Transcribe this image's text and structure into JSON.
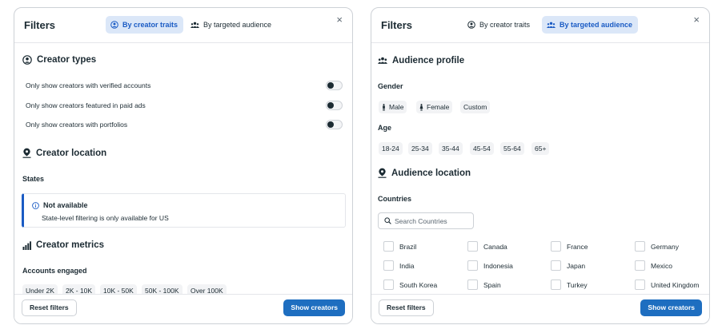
{
  "left_panel": {
    "title": "Filters",
    "tabs": [
      {
        "label": "By creator traits",
        "active": true
      },
      {
        "label": "By targeted audience",
        "active": false
      }
    ],
    "close_label": "×",
    "creator_types": {
      "title": "Creator types",
      "options": [
        {
          "label": "Only show creators with verified accounts",
          "on": true
        },
        {
          "label": "Only show creators featured in paid ads",
          "on": true
        },
        {
          "label": "Only show creators with portfolios",
          "on": true
        }
      ]
    },
    "creator_location": {
      "title": "Creator location",
      "states_label": "States",
      "notice_title": "Not available",
      "notice_body": "State-level filtering is only available for US"
    },
    "creator_metrics": {
      "title": "Creator metrics",
      "accounts_engaged_label": "Accounts engaged",
      "ranges": [
        "Under 2K",
        "2K - 10K",
        "10K - 50K",
        "50K - 100K",
        "Over 100K"
      ]
    },
    "footer": {
      "reset_label": "Reset filters",
      "show_label": "Show creators"
    }
  },
  "right_panel": {
    "title": "Filters",
    "tabs": [
      {
        "label": "By creator traits",
        "active": false
      },
      {
        "label": "By targeted audience",
        "active": true
      }
    ],
    "close_label": "×",
    "audience_profile": {
      "title": "Audience profile",
      "gender_label": "Gender",
      "genders": [
        "Male",
        "Female",
        "Custom"
      ],
      "age_label": "Age",
      "ages": [
        "18-24",
        "25-34",
        "35-44",
        "45-54",
        "55-64",
        "65+"
      ]
    },
    "audience_location": {
      "title": "Audience location",
      "countries_label": "Countries",
      "search_placeholder": "Search Countries",
      "countries": [
        "Brazil",
        "Canada",
        "France",
        "Germany",
        "India",
        "Indonesia",
        "Japan",
        "Mexico",
        "South Korea",
        "Spain",
        "Turkey",
        "United Kingdom"
      ]
    },
    "footer": {
      "reset_label": "Reset filters",
      "show_label": "Show creators"
    }
  },
  "colors": {
    "accent": "#1e6ec0",
    "tab_active_bg": "#dbe7f8",
    "text": "#1c2b33",
    "border": "#cdd1d6"
  }
}
